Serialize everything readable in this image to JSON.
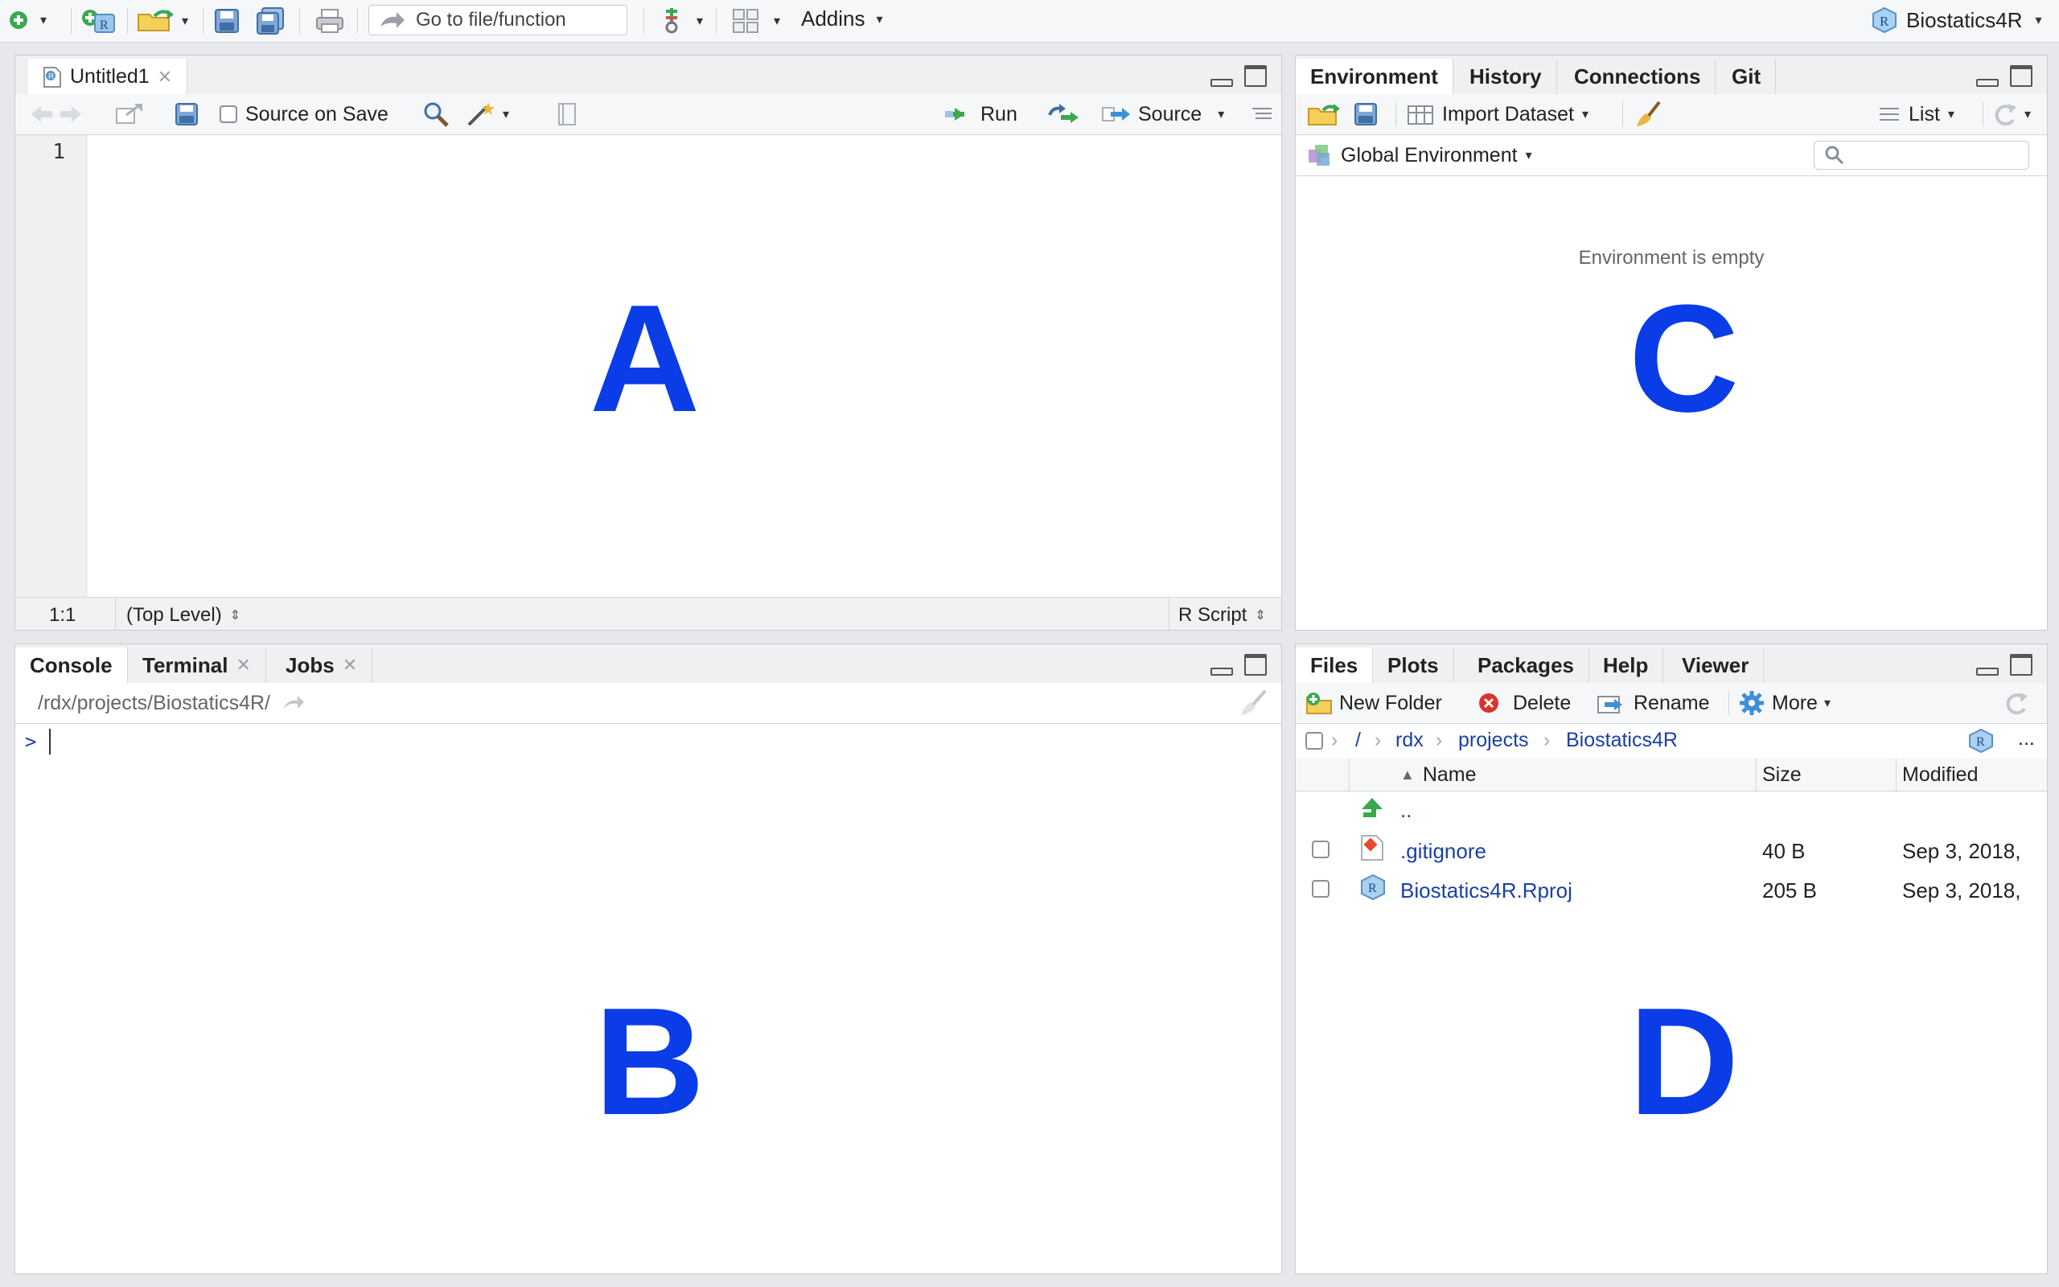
{
  "toolbar": {
    "goto_placeholder": "Go to file/function",
    "addins_label": "Addins",
    "project_label": "Biostatics4R"
  },
  "source_pane": {
    "tab_label": "Untitled1",
    "source_on_save": "Source on Save",
    "run_label": "Run",
    "source_label": "Source",
    "line_number": "1",
    "cursor_pos": "1:1",
    "scope": "(Top Level)",
    "file_type": "R Script",
    "marker": "A"
  },
  "console_pane": {
    "tabs": [
      "Console",
      "Terminal",
      "Jobs"
    ],
    "path": "/rdx/projects/Biostatics4R/",
    "prompt": ">",
    "marker": "B"
  },
  "env_pane": {
    "tabs": [
      "Environment",
      "History",
      "Connections",
      "Git"
    ],
    "import_dataset": "Import Dataset",
    "list_label": "List",
    "global_env": "Global Environment",
    "empty_msg": "Environment is empty",
    "marker": "C"
  },
  "files_pane": {
    "tabs": [
      "Files",
      "Plots",
      "Packages",
      "Help",
      "Viewer"
    ],
    "new_folder": "New Folder",
    "delete": "Delete",
    "rename": "Rename",
    "more": "More",
    "breadcrumb": [
      "/",
      "rdx",
      "projects",
      "Biostatics4R"
    ],
    "columns": [
      "Name",
      "Size",
      "Modified"
    ],
    "up_dir": "..",
    "ellipsis": "...",
    "rows": [
      {
        "name": ".gitignore",
        "size": "40 B",
        "modified": "Sep 3, 2018,"
      },
      {
        "name": "Biostatics4R.Rproj",
        "size": "205 B",
        "modified": "Sep 3, 2018,"
      }
    ],
    "marker": "D"
  },
  "colors": {
    "accent_blue": "#0a3ce8",
    "link_blue": "#1a3fa8",
    "green": "#3aa84f"
  }
}
